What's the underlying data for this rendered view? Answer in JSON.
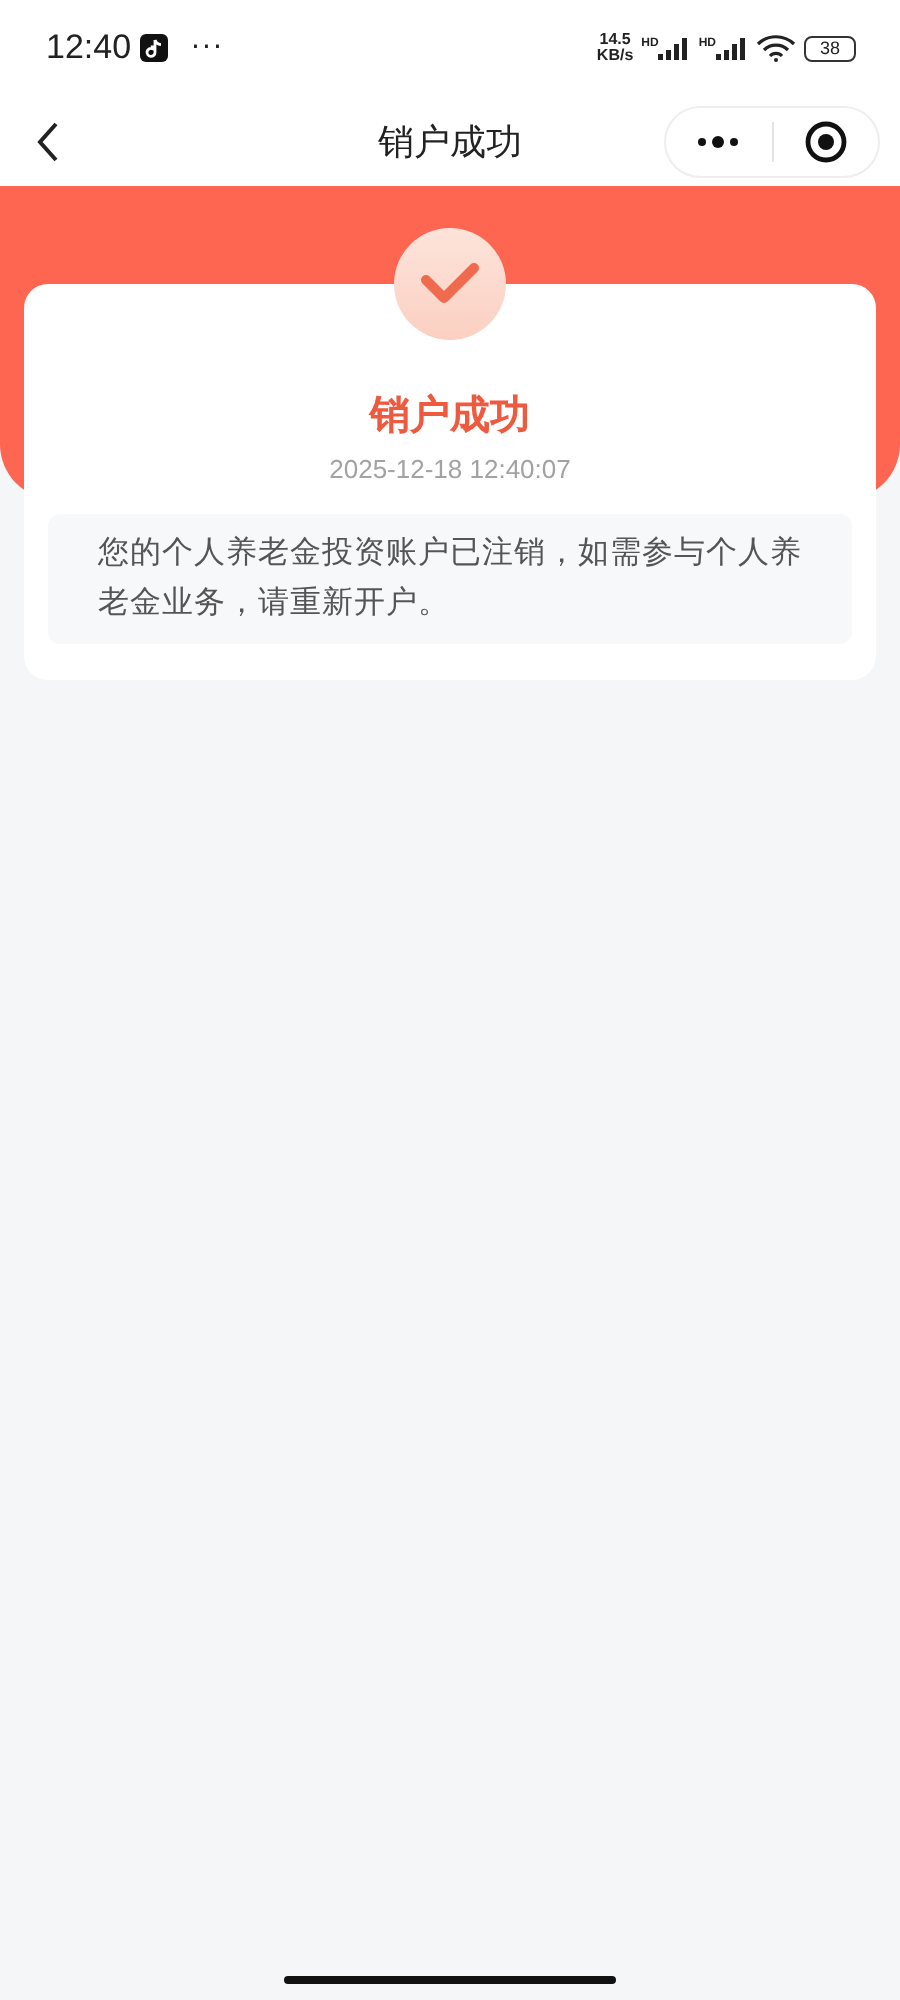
{
  "status_bar": {
    "time": "12:40",
    "more": "···",
    "speed_value": "14.5",
    "speed_unit": "KB/s",
    "sim_labels": [
      "HD",
      "HD"
    ],
    "battery": "38"
  },
  "nav_bar": {
    "title": "销户成功"
  },
  "result": {
    "title": "销户成功",
    "timestamp": "2025-12-18 12:40:07",
    "message": "您的个人养老金投资账户已注销，如需参与个人养老金业务，请重新开户。"
  }
}
